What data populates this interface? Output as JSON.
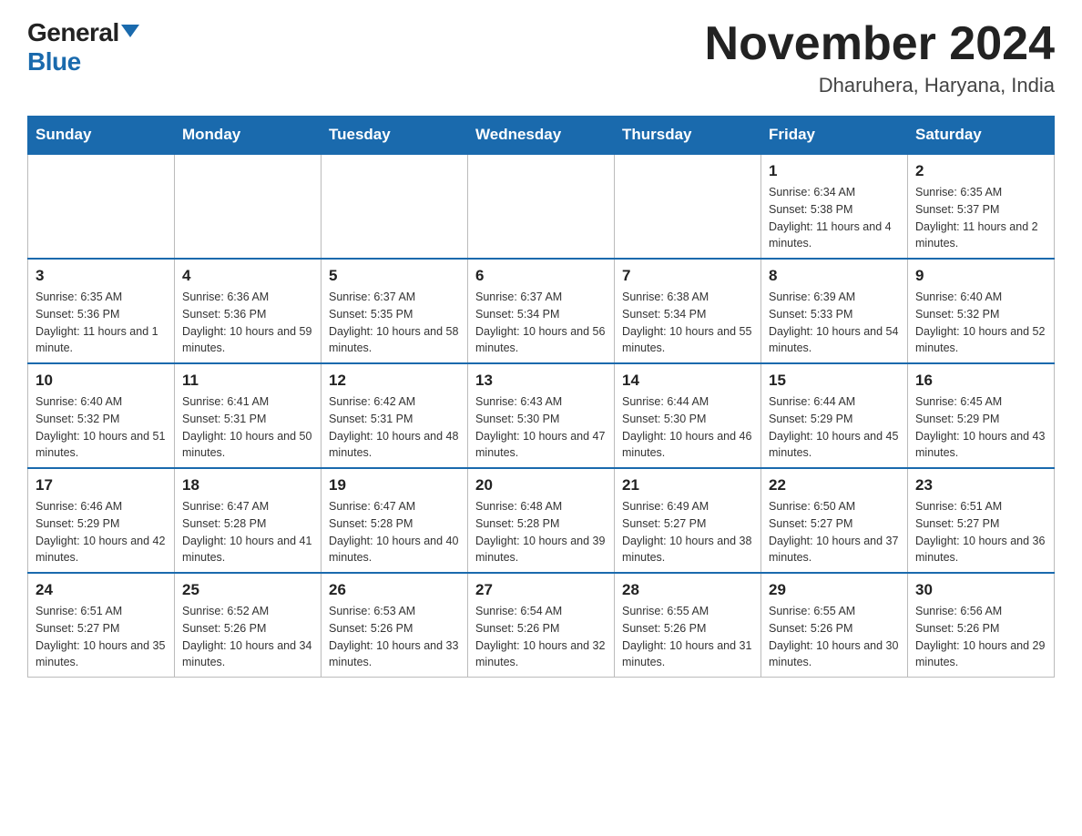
{
  "logo": {
    "general": "General",
    "blue": "Blue"
  },
  "title": "November 2024",
  "subtitle": "Dharuhera, Haryana, India",
  "days_of_week": [
    "Sunday",
    "Monday",
    "Tuesday",
    "Wednesday",
    "Thursday",
    "Friday",
    "Saturday"
  ],
  "weeks": [
    [
      {
        "day": "",
        "info": ""
      },
      {
        "day": "",
        "info": ""
      },
      {
        "day": "",
        "info": ""
      },
      {
        "day": "",
        "info": ""
      },
      {
        "day": "",
        "info": ""
      },
      {
        "day": "1",
        "info": "Sunrise: 6:34 AM\nSunset: 5:38 PM\nDaylight: 11 hours and 4 minutes."
      },
      {
        "day": "2",
        "info": "Sunrise: 6:35 AM\nSunset: 5:37 PM\nDaylight: 11 hours and 2 minutes."
      }
    ],
    [
      {
        "day": "3",
        "info": "Sunrise: 6:35 AM\nSunset: 5:36 PM\nDaylight: 11 hours and 1 minute."
      },
      {
        "day": "4",
        "info": "Sunrise: 6:36 AM\nSunset: 5:36 PM\nDaylight: 10 hours and 59 minutes."
      },
      {
        "day": "5",
        "info": "Sunrise: 6:37 AM\nSunset: 5:35 PM\nDaylight: 10 hours and 58 minutes."
      },
      {
        "day": "6",
        "info": "Sunrise: 6:37 AM\nSunset: 5:34 PM\nDaylight: 10 hours and 56 minutes."
      },
      {
        "day": "7",
        "info": "Sunrise: 6:38 AM\nSunset: 5:34 PM\nDaylight: 10 hours and 55 minutes."
      },
      {
        "day": "8",
        "info": "Sunrise: 6:39 AM\nSunset: 5:33 PM\nDaylight: 10 hours and 54 minutes."
      },
      {
        "day": "9",
        "info": "Sunrise: 6:40 AM\nSunset: 5:32 PM\nDaylight: 10 hours and 52 minutes."
      }
    ],
    [
      {
        "day": "10",
        "info": "Sunrise: 6:40 AM\nSunset: 5:32 PM\nDaylight: 10 hours and 51 minutes."
      },
      {
        "day": "11",
        "info": "Sunrise: 6:41 AM\nSunset: 5:31 PM\nDaylight: 10 hours and 50 minutes."
      },
      {
        "day": "12",
        "info": "Sunrise: 6:42 AM\nSunset: 5:31 PM\nDaylight: 10 hours and 48 minutes."
      },
      {
        "day": "13",
        "info": "Sunrise: 6:43 AM\nSunset: 5:30 PM\nDaylight: 10 hours and 47 minutes."
      },
      {
        "day": "14",
        "info": "Sunrise: 6:44 AM\nSunset: 5:30 PM\nDaylight: 10 hours and 46 minutes."
      },
      {
        "day": "15",
        "info": "Sunrise: 6:44 AM\nSunset: 5:29 PM\nDaylight: 10 hours and 45 minutes."
      },
      {
        "day": "16",
        "info": "Sunrise: 6:45 AM\nSunset: 5:29 PM\nDaylight: 10 hours and 43 minutes."
      }
    ],
    [
      {
        "day": "17",
        "info": "Sunrise: 6:46 AM\nSunset: 5:29 PM\nDaylight: 10 hours and 42 minutes."
      },
      {
        "day": "18",
        "info": "Sunrise: 6:47 AM\nSunset: 5:28 PM\nDaylight: 10 hours and 41 minutes."
      },
      {
        "day": "19",
        "info": "Sunrise: 6:47 AM\nSunset: 5:28 PM\nDaylight: 10 hours and 40 minutes."
      },
      {
        "day": "20",
        "info": "Sunrise: 6:48 AM\nSunset: 5:28 PM\nDaylight: 10 hours and 39 minutes."
      },
      {
        "day": "21",
        "info": "Sunrise: 6:49 AM\nSunset: 5:27 PM\nDaylight: 10 hours and 38 minutes."
      },
      {
        "day": "22",
        "info": "Sunrise: 6:50 AM\nSunset: 5:27 PM\nDaylight: 10 hours and 37 minutes."
      },
      {
        "day": "23",
        "info": "Sunrise: 6:51 AM\nSunset: 5:27 PM\nDaylight: 10 hours and 36 minutes."
      }
    ],
    [
      {
        "day": "24",
        "info": "Sunrise: 6:51 AM\nSunset: 5:27 PM\nDaylight: 10 hours and 35 minutes."
      },
      {
        "day": "25",
        "info": "Sunrise: 6:52 AM\nSunset: 5:26 PM\nDaylight: 10 hours and 34 minutes."
      },
      {
        "day": "26",
        "info": "Sunrise: 6:53 AM\nSunset: 5:26 PM\nDaylight: 10 hours and 33 minutes."
      },
      {
        "day": "27",
        "info": "Sunrise: 6:54 AM\nSunset: 5:26 PM\nDaylight: 10 hours and 32 minutes."
      },
      {
        "day": "28",
        "info": "Sunrise: 6:55 AM\nSunset: 5:26 PM\nDaylight: 10 hours and 31 minutes."
      },
      {
        "day": "29",
        "info": "Sunrise: 6:55 AM\nSunset: 5:26 PM\nDaylight: 10 hours and 30 minutes."
      },
      {
        "day": "30",
        "info": "Sunrise: 6:56 AM\nSunset: 5:26 PM\nDaylight: 10 hours and 29 minutes."
      }
    ]
  ]
}
